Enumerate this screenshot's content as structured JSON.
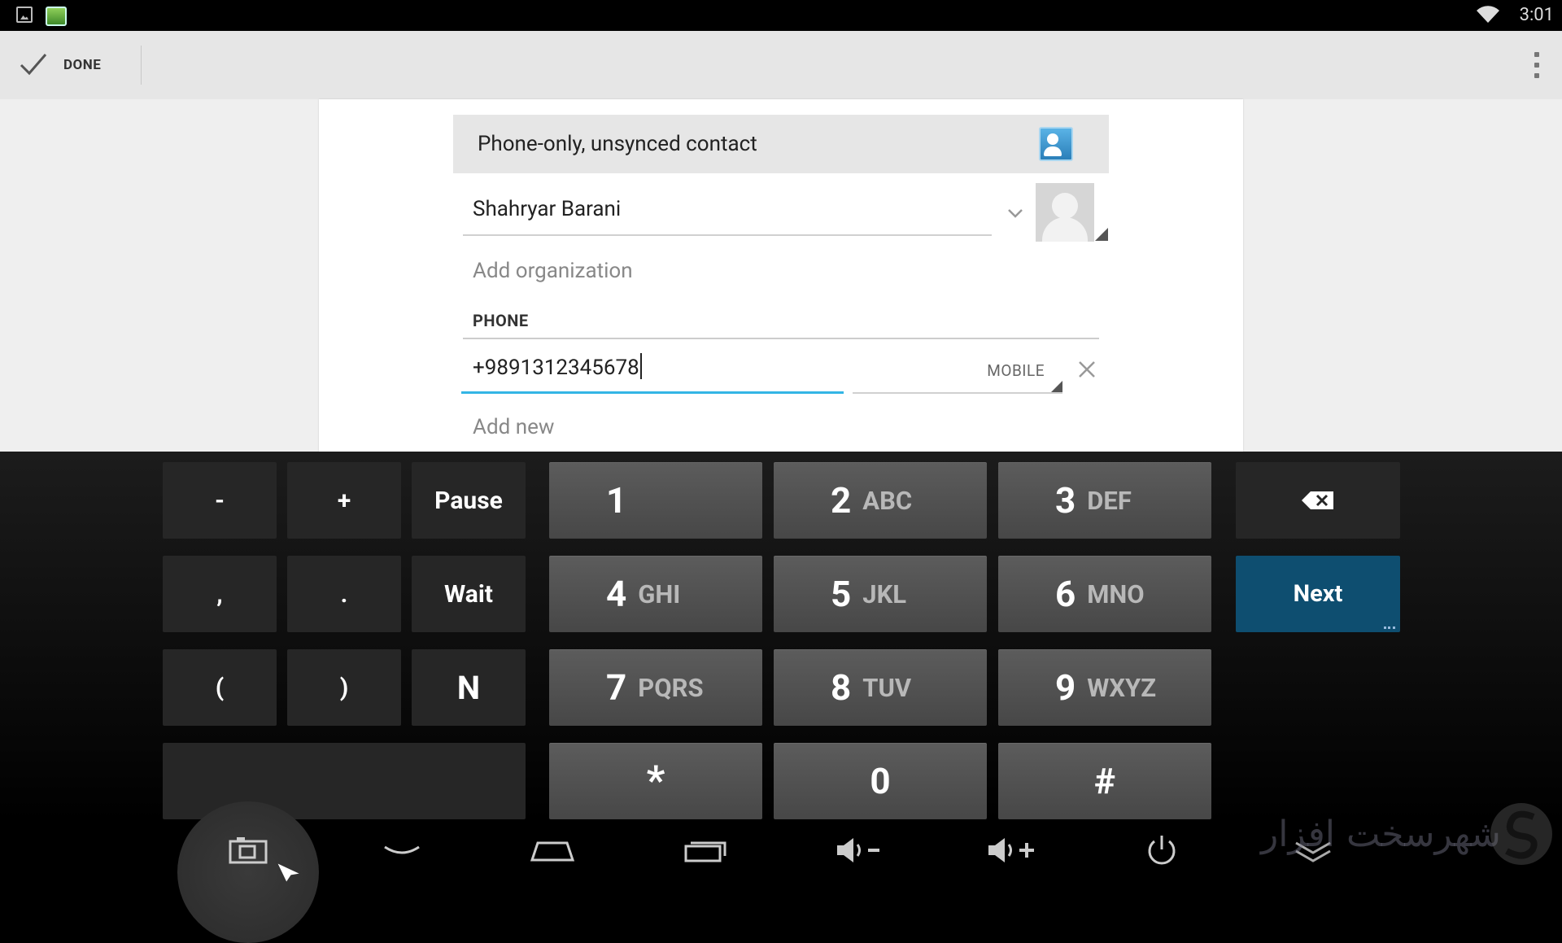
{
  "status_bar": {
    "time": "3:01"
  },
  "action_bar": {
    "done_label": "DONE"
  },
  "editor": {
    "account_label": "Phone-only, unsynced contact",
    "name_value": "Shahryar Barani",
    "add_organization": "Add organization",
    "phone_section_header": "PHONE",
    "phone_value": "+9891312345678",
    "phone_type": "MOBILE",
    "add_new": "Add new"
  },
  "keyboard": {
    "rows": [
      {
        "left": [
          "-",
          "+",
          "Pause"
        ],
        "digits": [
          {
            "digit": "1",
            "letters": ""
          },
          {
            "digit": "2",
            "letters": "ABC"
          },
          {
            "digit": "3",
            "letters": "DEF"
          }
        ]
      },
      {
        "left": [
          ",",
          ".",
          "Wait"
        ],
        "digits": [
          {
            "digit": "4",
            "letters": "GHI"
          },
          {
            "digit": "5",
            "letters": "JKL"
          },
          {
            "digit": "6",
            "letters": "MNO"
          }
        ]
      },
      {
        "left": [
          "(",
          ")",
          "N"
        ],
        "digits": [
          {
            "digit": "7",
            "letters": "PQRS"
          },
          {
            "digit": "8",
            "letters": "TUV"
          },
          {
            "digit": "9",
            "letters": "WXYZ"
          }
        ]
      },
      {
        "left": [],
        "digits": [
          {
            "digit": "*",
            "letters": ""
          },
          {
            "digit": "0",
            "letters": ""
          },
          {
            "digit": "#",
            "letters": ""
          }
        ]
      }
    ],
    "next_label": "Next",
    "backspace_icon": "backspace-icon"
  },
  "nav_bar": {
    "icons": [
      "screenshot-icon",
      "hide-keyboard-icon",
      "home-icon",
      "recents-icon",
      "volume-down-icon",
      "volume-up-icon",
      "power-icon",
      "collapse-icon"
    ]
  },
  "watermark": {
    "text": "شهرسخت افزار"
  },
  "colors": {
    "accent": "#33b5e5",
    "next_key": "#0e4e70",
    "action_bar": "#e6e6e6"
  }
}
